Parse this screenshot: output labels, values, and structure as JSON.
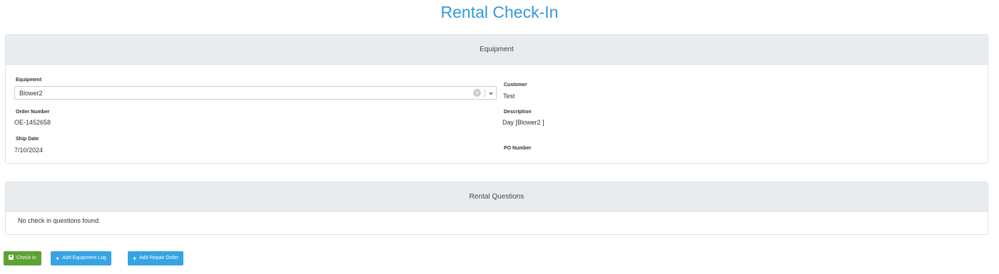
{
  "page": {
    "title": "Rental Check-In"
  },
  "equipment_panel": {
    "heading": "Equipment",
    "equipment": {
      "label": "Equipment",
      "value": "Blower2",
      "clear_icon": "clear-icon",
      "dropdown_icon": "chevron-down-icon"
    },
    "customer": {
      "label": "Customer",
      "value": "Test"
    },
    "order_number": {
      "label": "Order Number",
      "value": "OE-1452658"
    },
    "description": {
      "label": "Description",
      "value": "Day [Blower2 ]"
    },
    "ship_date": {
      "label": "Ship Date",
      "value": "7/10/2024"
    },
    "po_number": {
      "label": "PO Number",
      "value": ""
    }
  },
  "questions_panel": {
    "heading": "Rental Questions",
    "empty_message": "No check in questions found."
  },
  "actions": {
    "check_in": {
      "label": "Check In",
      "icon": "save-icon",
      "color": "#5ea233"
    },
    "add_equipment_log": {
      "label": "Add Equipment Log",
      "icon": "plus-icon",
      "color": "#36a3e3"
    },
    "add_repair_order": {
      "label": "Add Repair Order",
      "icon": "plus-icon",
      "color": "#36a3e3"
    }
  },
  "colors": {
    "title": "#3598dc",
    "panel_heading_bg": "#e9ecef"
  }
}
